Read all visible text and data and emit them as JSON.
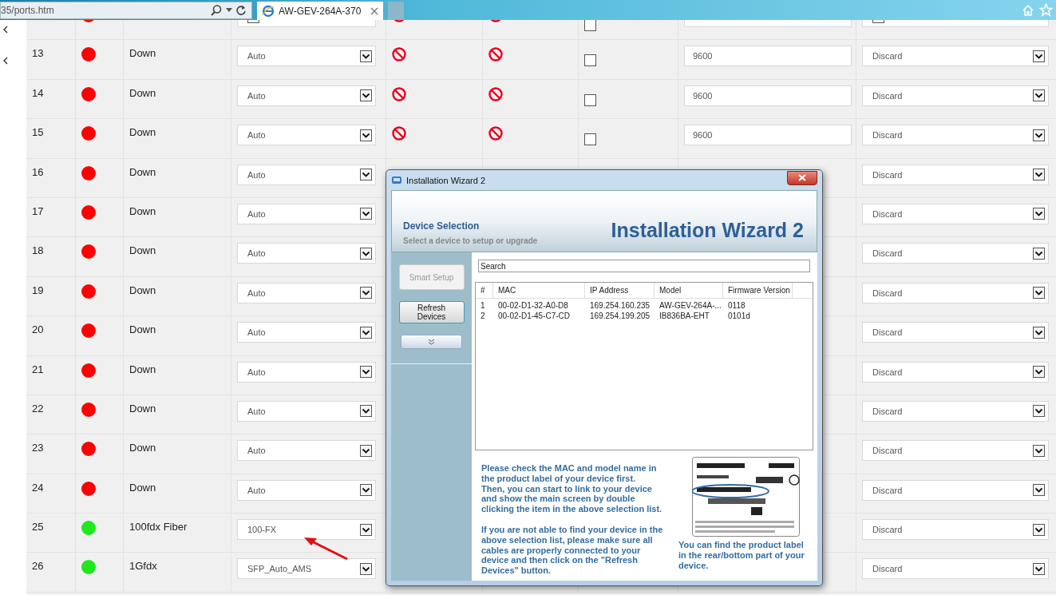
{
  "browser": {
    "address": "35/ports.htm",
    "tab_title": "AW-GEV-264A-370"
  },
  "ports": [
    {
      "kind": "cut",
      "color": "#ff0000",
      "blocked": true,
      "checked": false
    },
    {
      "kind": "full",
      "port": "13",
      "color": "#ff0000",
      "status": "Down",
      "speed": "Auto",
      "blocked": true,
      "checked": false,
      "frame": "9600",
      "action": "Discard"
    },
    {
      "kind": "full",
      "port": "14",
      "color": "#ff0000",
      "status": "Down",
      "speed": "Auto",
      "blocked": true,
      "checked": false,
      "frame": "9600",
      "action": "Discard"
    },
    {
      "kind": "full",
      "port": "15",
      "color": "#ff0000",
      "status": "Down",
      "speed": "Auto",
      "blocked": true,
      "checked": false,
      "frame": "9600",
      "action": "Discard"
    },
    {
      "kind": "full",
      "port": "16",
      "color": "#ff0000",
      "status": "Down",
      "speed": "Auto",
      "action": "Discard"
    },
    {
      "kind": "full",
      "port": "17",
      "color": "#ff0000",
      "status": "Down",
      "speed": "Auto",
      "action": "Discard"
    },
    {
      "kind": "full",
      "port": "18",
      "color": "#ff0000",
      "status": "Down",
      "speed": "Auto",
      "action": "Discard"
    },
    {
      "kind": "full",
      "port": "19",
      "color": "#ff0000",
      "status": "Down",
      "speed": "Auto",
      "action": "Discard"
    },
    {
      "kind": "full",
      "port": "20",
      "color": "#ff0000",
      "status": "Down",
      "speed": "Auto",
      "action": "Discard"
    },
    {
      "kind": "full",
      "port": "21",
      "color": "#ff0000",
      "status": "Down",
      "speed": "Auto",
      "action": "Discard"
    },
    {
      "kind": "full",
      "port": "22",
      "color": "#ff0000",
      "status": "Down",
      "speed": "Auto",
      "action": "Discard"
    },
    {
      "kind": "full",
      "port": "23",
      "color": "#ff0000",
      "status": "Down",
      "speed": "Auto",
      "action": "Discard"
    },
    {
      "kind": "full",
      "port": "24",
      "color": "#ff0000",
      "status": "Down",
      "speed": "Auto",
      "action": "Discard"
    },
    {
      "kind": "full",
      "port": "25",
      "color": "#1ee81e",
      "status": "100fdx Fiber",
      "speed": "100-FX",
      "action": "Discard"
    },
    {
      "kind": "full",
      "port": "26",
      "color": "#1ee81e",
      "status": "1Gfdx",
      "speed": "SFP_Auto_AMS",
      "action": "Discard"
    }
  ],
  "wizard": {
    "title": "Installation Wizard 2",
    "heading": "Device Selection",
    "subheading": "Select a device to setup or upgrade",
    "banner": "Installation Wizard 2",
    "buttons": [
      {
        "label": "Smart Setup",
        "disabled": true
      },
      {
        "label": "Refresh Devices",
        "disabled": false
      }
    ],
    "search": {
      "placeholder": "Search"
    },
    "columns": [
      "#",
      "MAC",
      "IP Address",
      "Model",
      "Firmware Version"
    ],
    "devices": [
      [
        "1",
        "00-02-D1-32-A0-D8",
        "169.254.160.235",
        "AW-GEV-264A-...",
        "0118"
      ],
      [
        "2",
        "00-02-D1-45-C7-CD",
        "169.254.199.205",
        "IB836BA-EHT",
        "0101d"
      ]
    ],
    "help": [
      [
        "Please check the MAC and model name in the product label of your device first.",
        "Then, you can start to link to your device and show the main screen by double clicking the item in the above selection list."
      ],
      [
        "If you are not able to find your device in the above selection list, please make sure all cables are properly connected to your device and then click on the \"Refresh Devices\" button."
      ]
    ],
    "label_caption": "You can find the product label in the rear/bottom part of your device."
  }
}
